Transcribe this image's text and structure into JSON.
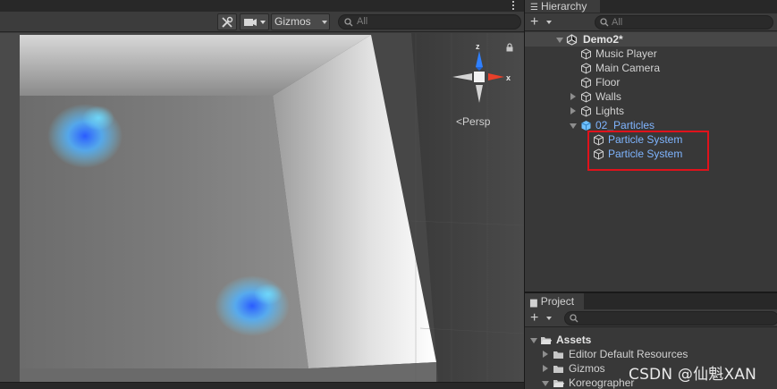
{
  "scene_view": {
    "toolbar": {
      "tools_icon": "tools-icon",
      "camera_icon": "camera-icon",
      "gizmos_label": "Gizmos",
      "search_placeholder": "All"
    },
    "gizmo": {
      "axis_z": "z",
      "axis_x": "x",
      "projection_label": "Persp"
    }
  },
  "hierarchy": {
    "tab_label": "Hierarchy",
    "search_placeholder": "All",
    "scene": "Demo2*",
    "items": [
      {
        "label": "Music Player",
        "expandable": false,
        "selected": false
      },
      {
        "label": "Main Camera",
        "expandable": false,
        "selected": false
      },
      {
        "label": "Floor",
        "expandable": false,
        "selected": false
      },
      {
        "label": "Walls",
        "expandable": true,
        "selected": false
      },
      {
        "label": "Lights",
        "expandable": true,
        "selected": false
      },
      {
        "label": "02_Particles",
        "expandable": true,
        "expanded": true,
        "prefab": true
      },
      {
        "label": "Particle System",
        "child": true
      },
      {
        "label": "Particle System",
        "child": true
      }
    ]
  },
  "project": {
    "tab_label": "Project",
    "root_folder": "Assets",
    "folders": [
      "Editor Default Resources",
      "Gizmos",
      "Koreographer"
    ]
  },
  "watermark": "CSDN @仙魁XAN",
  "colors": {
    "panel_bg": "#383838",
    "toolbar_bg": "#3c3c3c",
    "selected_text": "#7fb5ff",
    "highlight_box": "#e0121b",
    "gizmo_x": "#e8402a",
    "gizmo_z": "#2f80ff"
  }
}
